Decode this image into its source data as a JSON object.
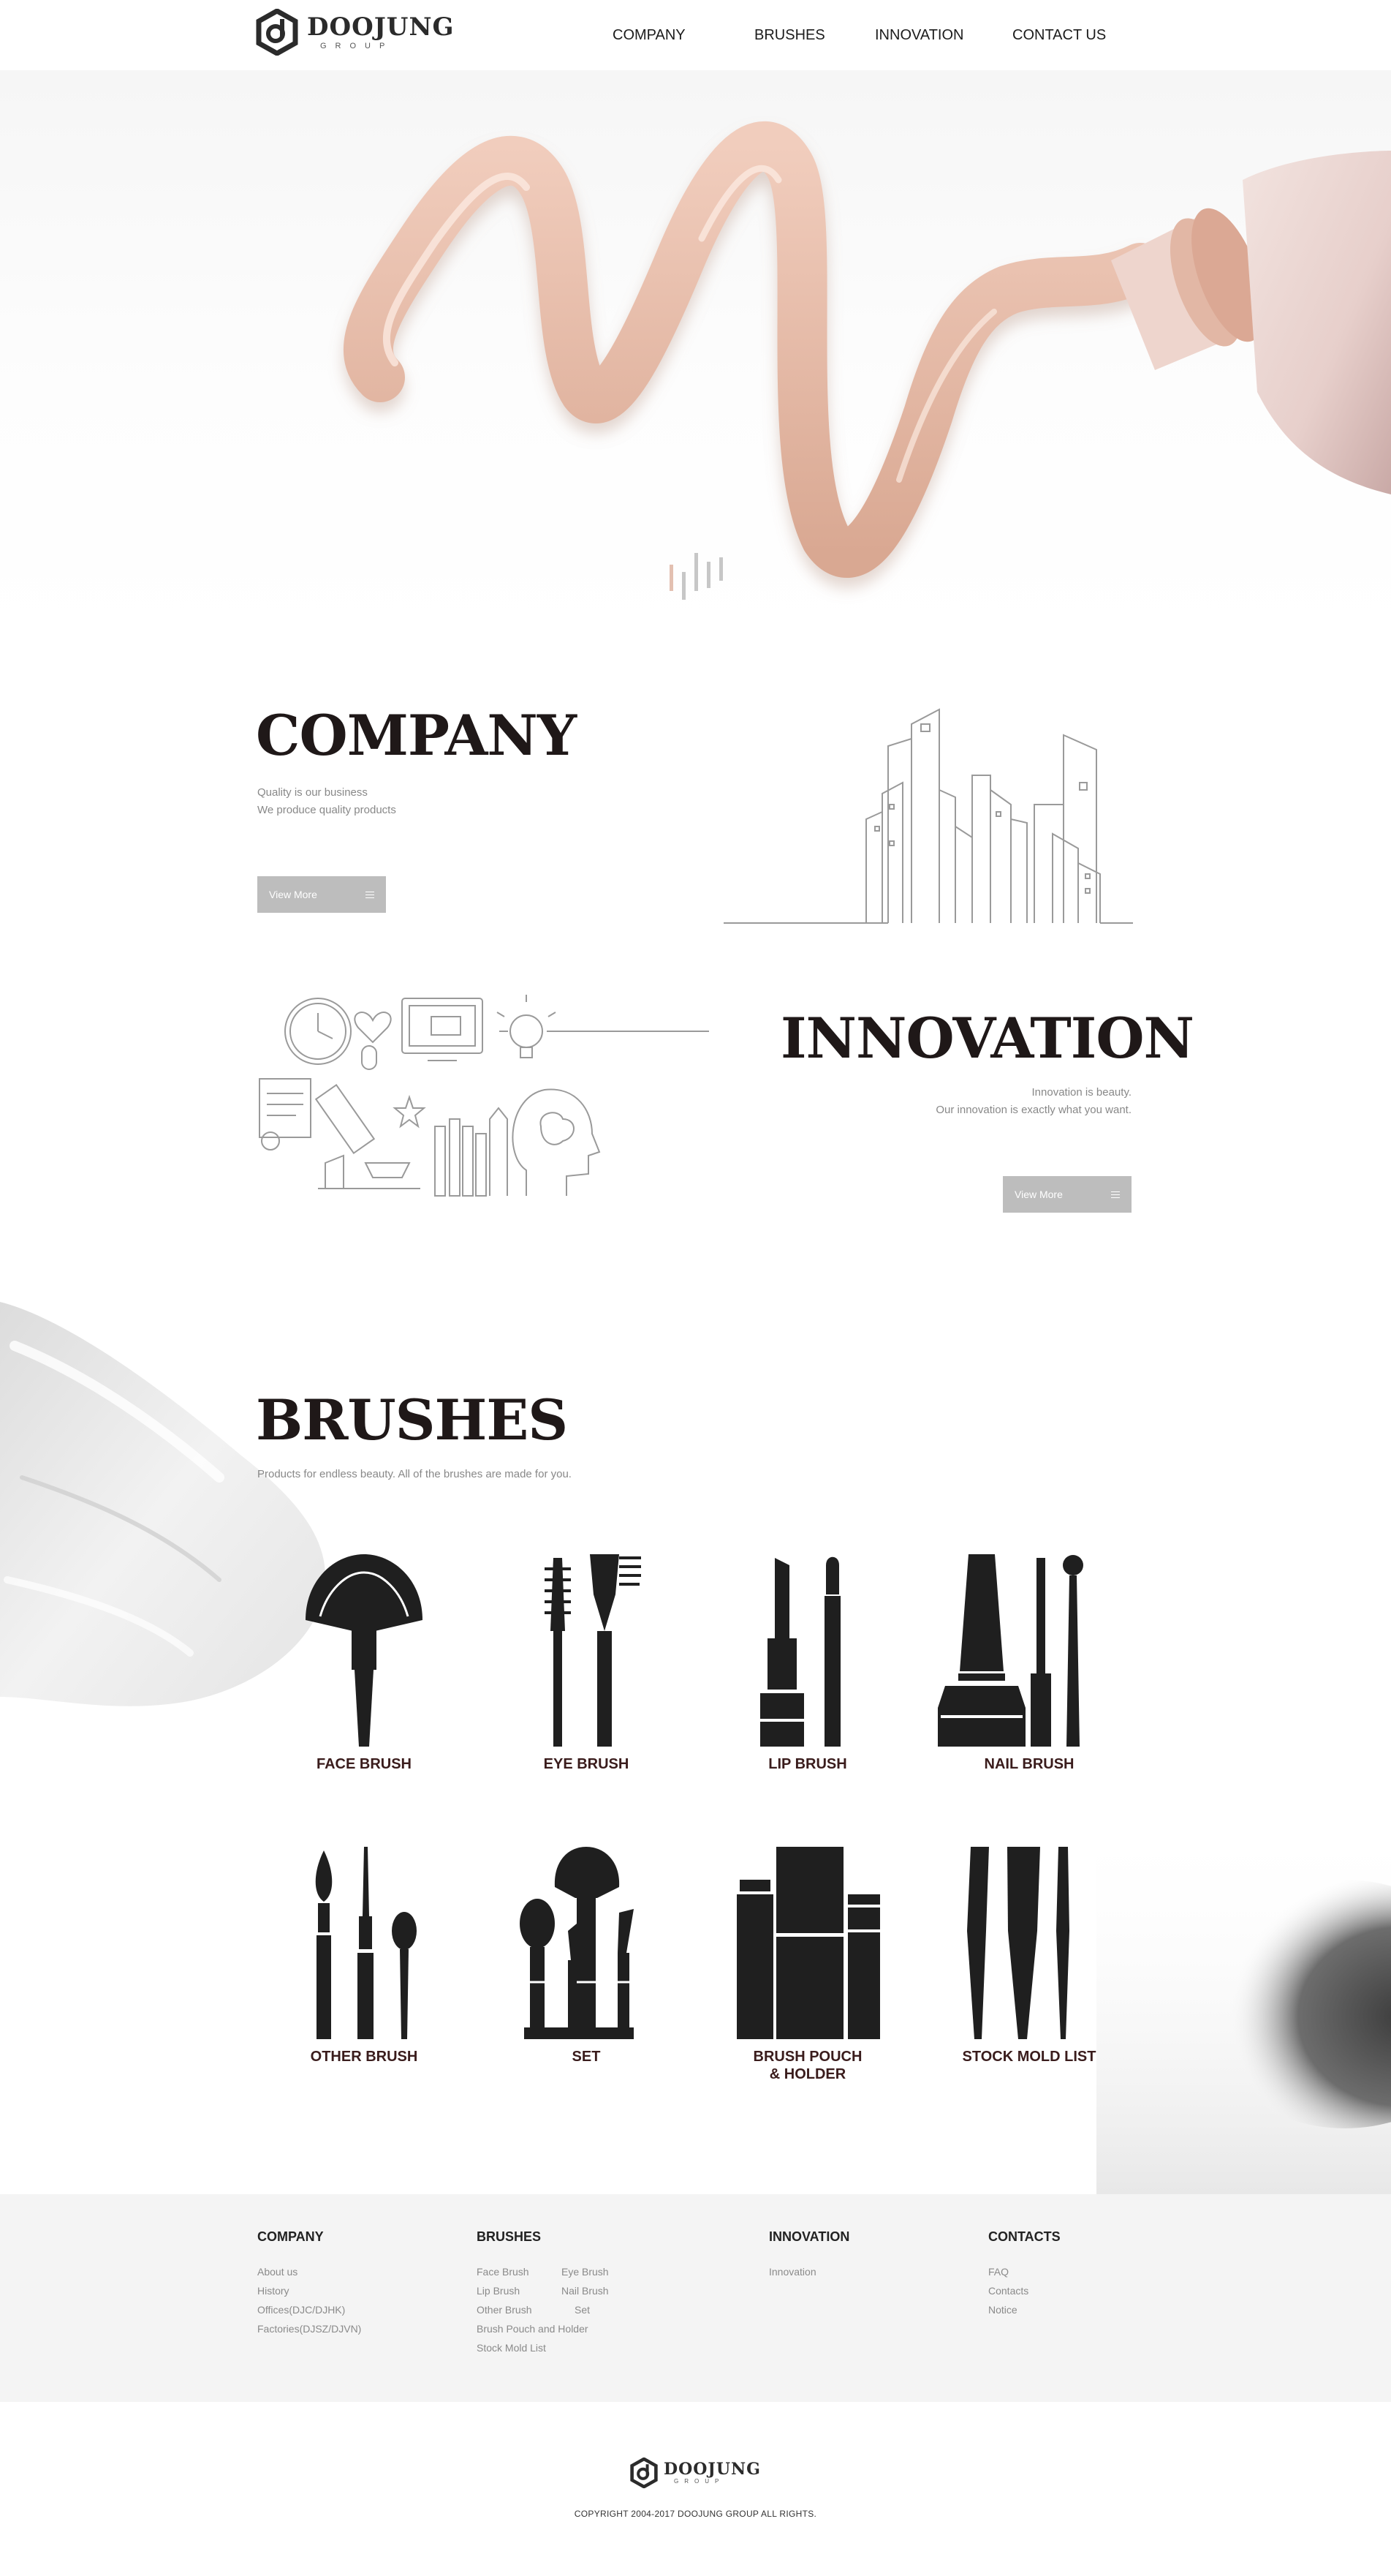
{
  "header": {
    "logo_name": "DOOJUNG",
    "logo_sub": "GROUP",
    "nav": [
      {
        "label": "COMPANY"
      },
      {
        "label": "BRUSHES"
      },
      {
        "label": "INNOVATION"
      },
      {
        "label": "CONTACT US"
      }
    ]
  },
  "hero": {
    "accent_color": "#e8c2b0"
  },
  "company": {
    "title": "COMPANY",
    "lines": [
      "Quality is our business",
      "We produce quality products"
    ],
    "button_label": "View More"
  },
  "innovation": {
    "title": "INNOVATION",
    "lines": [
      "Innovation is beauty.",
      "Our innovation is exactly what you want."
    ],
    "button_label": "View More"
  },
  "brushes": {
    "title": "BRUSHES",
    "subtitle": "Products for endless beauty. All of the brushes are made for you.",
    "items": [
      {
        "label": "FACE BRUSH",
        "icon": "face-brush-icon"
      },
      {
        "label": "EYE BRUSH",
        "icon": "eye-brush-icon"
      },
      {
        "label": "LIP BRUSH",
        "icon": "lip-brush-icon"
      },
      {
        "label": "NAIL BRUSH",
        "icon": "nail-brush-icon"
      },
      {
        "label": "OTHER BRUSH",
        "icon": "other-brush-icon"
      },
      {
        "label": "SET",
        "icon": "brush-set-icon"
      },
      {
        "label": "BRUSH POUCH",
        "label2": "& HOLDER",
        "icon": "brush-pouch-icon"
      },
      {
        "label": "STOCK MOLD LIST",
        "icon": "stock-mold-icon"
      }
    ]
  },
  "footer": {
    "columns": [
      {
        "title": "COMPANY",
        "links": [
          "About us",
          "History",
          "Offices(DJC/DJHK)",
          "Factories(DJSZ/DJVN)"
        ]
      },
      {
        "title": "BRUSHES",
        "links": [
          "Face Brush",
          "Eye Brush",
          "Lip Brush",
          "Nail Brush",
          "Other Brush",
          "Set",
          "Brush Pouch and Holder",
          "Stock Mold List"
        ]
      },
      {
        "title": "INNOVATION",
        "links": [
          "Innovation"
        ]
      },
      {
        "title": "CONTACTS",
        "links": [
          "FAQ",
          "Contacts",
          "Notice"
        ]
      }
    ],
    "logo_name": "DOOJUNG",
    "logo_sub": "GROUP",
    "copyright": "COPYRIGHT 2004-2017 DOOJUNG GROUP ALL RIGHTS."
  }
}
